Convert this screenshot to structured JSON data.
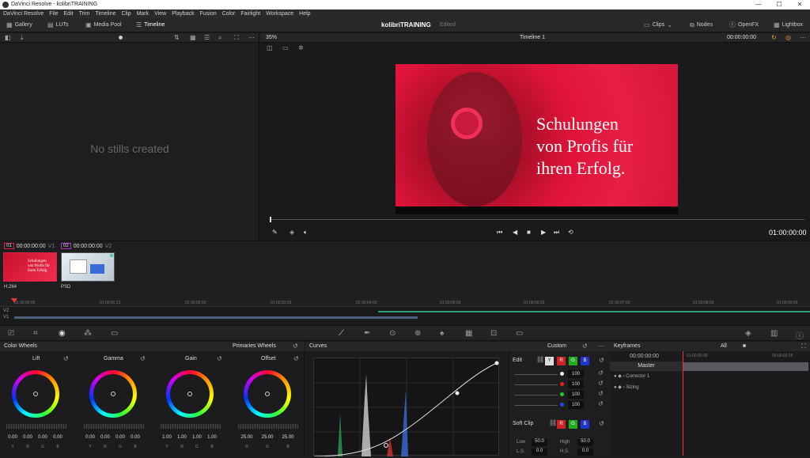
{
  "window": {
    "title": "DaVinci Resolve - kolibriTRAINING",
    "min": "—",
    "max": "☐",
    "close": "✕"
  },
  "menu": [
    "DaVinci Resolve",
    "File",
    "Edit",
    "Trim",
    "Timeline",
    "Clip",
    "Mark",
    "View",
    "Playback",
    "Fusion",
    "Color",
    "Fairlight",
    "Workspace",
    "Help"
  ],
  "toolbar": {
    "gallery": "Gallery",
    "luts": "LUTs",
    "media_pool": "Media Pool",
    "timeline": "Timeline",
    "project": "kolibriTRAINING",
    "status": "Edited",
    "clips": "Clips",
    "nodes": "Nodes",
    "openfx": "OpenFX",
    "lightbox": "Lightbox"
  },
  "gallery": {
    "empty": "No stills created"
  },
  "viewer": {
    "zoom": "35%",
    "timeline_name": "Timeline 1",
    "timecode_top": "00:00:00:00",
    "timecode": "01:00:00:00",
    "slogan": [
      "Schulungen",
      "von Profis für",
      "ihren Erfolg."
    ]
  },
  "clips": [
    {
      "num": "01",
      "tc": "00:00:00:00",
      "track": "V1",
      "codec": "H.264"
    },
    {
      "num": "02",
      "tc": "00:00:00:00",
      "track": "V2",
      "codec": "PSD"
    }
  ],
  "ruler": [
    "01:00:00:00",
    "01:00:01:13",
    "01:00:02:03",
    "01:00:03:03",
    "01:00:04:03",
    "01:00:05:03",
    "01:00:06:03",
    "01:00:07:03",
    "01:00:08:03",
    "01:00:09:03"
  ],
  "tracks": [
    "V2",
    "V1"
  ],
  "color_wheels": {
    "title": "Color Wheels",
    "mode": "Primaries Wheels",
    "wheels": [
      {
        "name": "Lift",
        "vals": [
          "0.00",
          "0.00",
          "0.00",
          "0.00"
        ]
      },
      {
        "name": "Gamma",
        "vals": [
          "0.00",
          "0.00",
          "0.00",
          "0.00"
        ]
      },
      {
        "name": "Gain",
        "vals": [
          "1.00",
          "1.00",
          "1.00",
          "1.00"
        ]
      },
      {
        "name": "Offset",
        "vals": [
          "25.00",
          "25.00",
          "25.00"
        ]
      }
    ],
    "ch4": [
      "Y",
      "R",
      "G",
      "B"
    ],
    "ch3": [
      "R",
      "G",
      "B"
    ]
  },
  "curves": {
    "title": "Curves",
    "mode": "Custom"
  },
  "edit": {
    "title": "Edit",
    "values": [
      "100",
      "100",
      "100",
      "100"
    ],
    "softclip": "Soft Clip",
    "low_label": "Low",
    "low": "50.0",
    "high_label": "High",
    "high": "50.0",
    "ls_label": "L.S.",
    "ls": "0.0",
    "hs_label": "H.S.",
    "hs": "0.0",
    "btn_y": "Y",
    "btn_r": "R",
    "btn_g": "G",
    "btn_b": "B"
  },
  "keyframes": {
    "title": "Keyframes",
    "filter": "All",
    "tc": "00:00:00:00",
    "tc2": "01:00:00:00",
    "tc3": "00:00:03:25",
    "master": "Master",
    "rows": [
      "Corrector 1",
      "Sizing"
    ]
  }
}
